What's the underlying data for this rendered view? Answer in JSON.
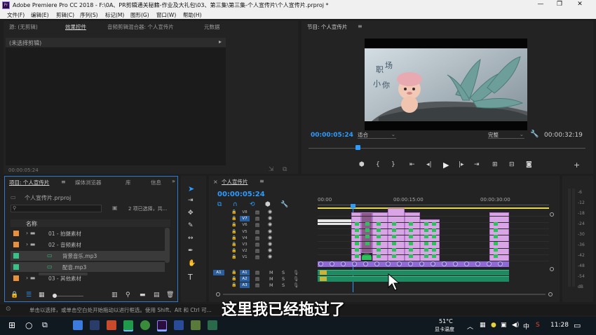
{
  "window": {
    "app_icon": "Pr",
    "title": "Adobe Premiere Pro CC 2018 - F:\\0A、PR剪辑通关秘籍-作业及大礼包\\03、第三集\\第三集-个人宣传片\\个人宣传片.prproj *"
  },
  "menu": [
    "文件(F)",
    "编辑(E)",
    "剪辑(C)",
    "序列(S)",
    "标记(M)",
    "图形(G)",
    "窗口(W)",
    "帮助(H)"
  ],
  "source_panel": {
    "tabs": [
      "源: (无剪辑)",
      "效果控件",
      "音频剪辑混合器: 个人宣传片",
      "元数据"
    ],
    "no_clip": "(未选择剪辑)",
    "timecode": "00:00:05:24"
  },
  "program_monitor": {
    "title": "节目: 个人宣传片",
    "video_text": [
      "职",
      "场",
      "小",
      "你"
    ],
    "timecode": "00:00:05:24",
    "fit": "适合",
    "quality": "完整",
    "duration": "00:00:32:19",
    "playhead_fraction": 0.177
  },
  "project_panel": {
    "tabs": [
      "项目: 个人宣传片",
      "媒体浏览器",
      "库",
      "信息"
    ],
    "file": "个人宣传片.prproj",
    "selection": "2 项已选择，共...",
    "column_name": "名称",
    "items": [
      {
        "label": "01 - 拍摄素材",
        "color": "#e8913a",
        "type": "folder"
      },
      {
        "label": "02 - 音频素材",
        "color": "#e8913a",
        "type": "folder"
      },
      {
        "label": "背景音乐.mp3",
        "color": "#35c486",
        "type": "audio"
      },
      {
        "label": "配音.mp3",
        "color": "#35c486",
        "type": "audio"
      },
      {
        "label": "03 - 其他素材",
        "color": "#e8913a",
        "type": "folder"
      }
    ]
  },
  "timeline": {
    "tab": "个人宣传片",
    "timecode": "00:00:05:24",
    "ruler": [
      "00:00",
      "00:00:15:00",
      "00:00:30:00"
    ],
    "video_tracks": [
      "V8",
      "V7",
      "V6",
      "V5",
      "V4",
      "V3",
      "V2",
      "V1"
    ],
    "audio_tracks": [
      "A1",
      "A2",
      "A3"
    ],
    "source_patch": "A1",
    "meter_labels": [
      "-6",
      "-12",
      "-18",
      "-24",
      "-30",
      "-36",
      "-42",
      "-48",
      "-54",
      "dB"
    ],
    "m_label": "M",
    "s_label": "S"
  },
  "status": {
    "hint": "单击以选择，或单击空白处开始拖动以进行框选。使用 Shift、Alt 和 Ctrl 可..."
  },
  "subtitle": "这里我已经拖过了",
  "taskbar": {
    "weather_temp": "51°C",
    "weather_label": "显卡温度",
    "ime": "中",
    "time": "11:28"
  },
  "colors": {
    "accent": "#2e9bff",
    "video_clip": "#d9a5e6",
    "audio_clip": "#1f8a62",
    "playhead": "#2e9bff"
  }
}
